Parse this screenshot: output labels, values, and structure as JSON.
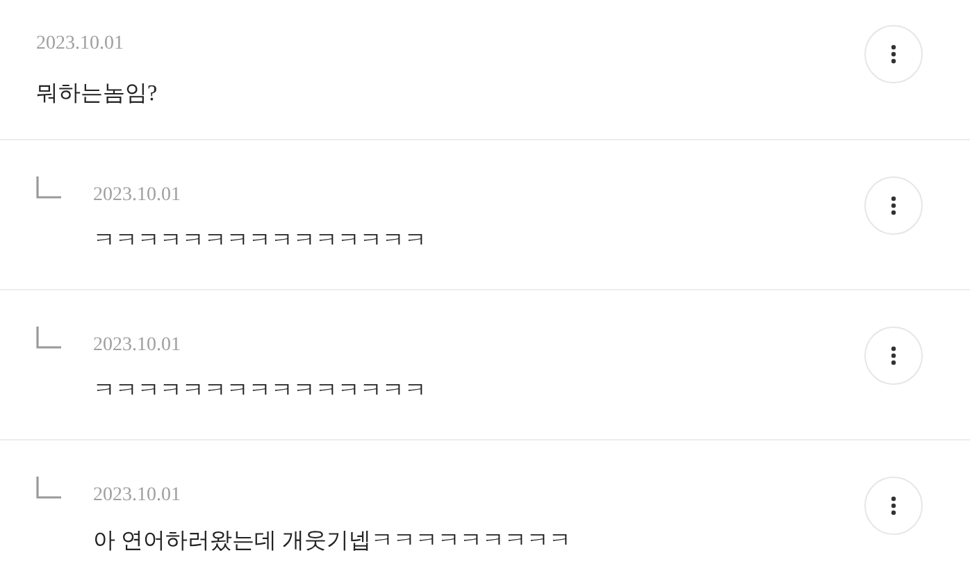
{
  "comments": [
    {
      "kind": "comment",
      "date": "2023.10.01",
      "text": "뭐하는놈임?"
    },
    {
      "kind": "reply",
      "date": "2023.10.01",
      "text": "ㅋㅋㅋㅋㅋㅋㅋㅋㅋㅋㅋㅋㅋㅋㅋ"
    },
    {
      "kind": "reply",
      "date": "2023.10.01",
      "text": "ㅋㅋㅋㅋㅋㅋㅋㅋㅋㅋㅋㅋㅋㅋㅋ"
    },
    {
      "kind": "reply",
      "date": "2023.10.01",
      "text": "아 연어하러왔는데 개웃기넵ㅋㅋㅋㅋㅋㅋㅋㅋㅋ"
    }
  ]
}
